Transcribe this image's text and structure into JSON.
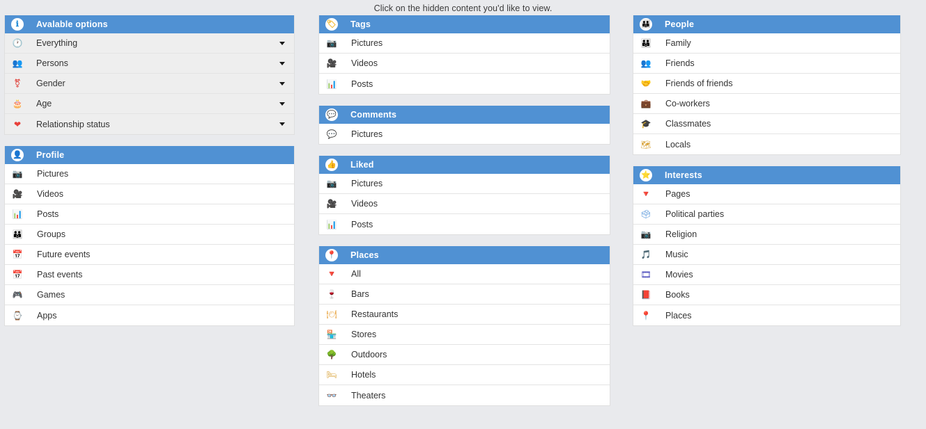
{
  "page": {
    "instruction": "Click on the hidden content you'd like to view.",
    "accent_color": "#5091d3",
    "background_color": "#e9eaed",
    "row_background": "#ffffff",
    "gray_row_background": "#eeeeee",
    "text_color": "#333333"
  },
  "columns": [
    {
      "name": "left",
      "panels": [
        {
          "id": "available-options",
          "title": "Avalable options",
          "header_icon": "info-circle-icon",
          "header_icon_glyph": "ℹ",
          "style": "gray",
          "collapsible": true,
          "items": [
            {
              "label": "Everything",
              "icon": "clock-icon",
              "glyph": "🕐"
            },
            {
              "label": "Persons",
              "icon": "people-icon",
              "glyph": "👥"
            },
            {
              "label": "Gender",
              "icon": "gender-icon",
              "glyph": "⚧"
            },
            {
              "label": "Age",
              "icon": "birthday-cake-icon",
              "glyph": "🎂"
            },
            {
              "label": "Relationship status",
              "icon": "heart-icon",
              "glyph": "❤"
            }
          ]
        },
        {
          "id": "profile",
          "title": "Profile",
          "header_icon": "person-badge-icon",
          "header_icon_glyph": "👤",
          "style": "white",
          "collapsible": false,
          "items": [
            {
              "label": "Pictures",
              "icon": "camera-icon",
              "glyph": "📷"
            },
            {
              "label": "Videos",
              "icon": "movie-camera-icon",
              "glyph": "🎥"
            },
            {
              "label": "Posts",
              "icon": "bar-chart-icon",
              "glyph": "📊"
            },
            {
              "label": "Groups",
              "icon": "group-icon",
              "glyph": "👪"
            },
            {
              "label": "Future events",
              "icon": "calendar-icon",
              "glyph": "📅"
            },
            {
              "label": "Past events",
              "icon": "calendar-icon",
              "glyph": "📅"
            },
            {
              "label": "Games",
              "icon": "gamepad-icon",
              "glyph": "🎮"
            },
            {
              "label": "Apps",
              "icon": "watch-icon",
              "glyph": "⌚"
            }
          ]
        }
      ]
    },
    {
      "name": "middle",
      "panels": [
        {
          "id": "tags",
          "title": "Tags",
          "header_icon": "tag-icon",
          "header_icon_glyph": "🏷",
          "style": "white",
          "collapsible": false,
          "items": [
            {
              "label": "Pictures",
              "icon": "camera-icon",
              "glyph": "📷"
            },
            {
              "label": "Videos",
              "icon": "movie-camera-icon",
              "glyph": "🎥"
            },
            {
              "label": "Posts",
              "icon": "bar-chart-icon",
              "glyph": "📊"
            }
          ]
        },
        {
          "id": "comments",
          "title": "Comments",
          "header_icon": "comment-icon",
          "header_icon_glyph": "💬",
          "style": "white",
          "collapsible": false,
          "items": [
            {
              "label": "Pictures",
              "icon": "speech-bubble-icon",
              "glyph": "💬"
            }
          ]
        },
        {
          "id": "liked",
          "title": "Liked",
          "header_icon": "thumbs-up-icon",
          "header_icon_glyph": "👍",
          "style": "white",
          "collapsible": false,
          "items": [
            {
              "label": "Pictures",
              "icon": "camera-icon",
              "glyph": "📷"
            },
            {
              "label": "Videos",
              "icon": "movie-camera-icon",
              "glyph": "🎥"
            },
            {
              "label": "Posts",
              "icon": "bar-chart-icon",
              "glyph": "📊"
            }
          ]
        },
        {
          "id": "places",
          "title": "Places",
          "header_icon": "map-pin-icon",
          "header_icon_glyph": "📍",
          "style": "white",
          "collapsible": false,
          "items": [
            {
              "label": "All",
              "icon": "filter-icon",
              "glyph": "🔻"
            },
            {
              "label": "Bars",
              "icon": "wine-glass-icon",
              "glyph": "🍷"
            },
            {
              "label": "Restaurants",
              "icon": "menu-card-icon",
              "glyph": "🍽"
            },
            {
              "label": "Stores",
              "icon": "store-icon",
              "glyph": "🏪"
            },
            {
              "label": "Outdoors",
              "icon": "tree-icon",
              "glyph": "🌳"
            },
            {
              "label": "Hotels",
              "icon": "bed-icon",
              "glyph": "🛏"
            },
            {
              "label": "Theaters",
              "icon": "3d-glasses-icon",
              "glyph": "👓"
            }
          ]
        }
      ]
    },
    {
      "name": "right",
      "panels": [
        {
          "id": "people",
          "title": "People",
          "header_icon": "people-circle-icon",
          "header_icon_glyph": "👪",
          "style": "white",
          "collapsible": false,
          "items": [
            {
              "label": "Family",
              "icon": "family-icon",
              "glyph": "👪"
            },
            {
              "label": "Friends",
              "icon": "two-faces-icon",
              "glyph": "👥"
            },
            {
              "label": "Friends of friends",
              "icon": "handshake-icon",
              "glyph": "🤝"
            },
            {
              "label": "Co-workers",
              "icon": "briefcase-icon",
              "glyph": "💼"
            },
            {
              "label": "Classmates",
              "icon": "graduation-cap-icon",
              "glyph": "🎓"
            },
            {
              "label": "Locals",
              "icon": "map-icon",
              "glyph": "🗺"
            }
          ]
        },
        {
          "id": "interests",
          "title": "Interests",
          "header_icon": "star-icon",
          "header_icon_glyph": "⭐",
          "style": "white",
          "collapsible": false,
          "items": [
            {
              "label": "Pages",
              "icon": "filter-icon",
              "glyph": "🔻"
            },
            {
              "label": "Political parties",
              "icon": "podium-icon",
              "glyph": "🗳"
            },
            {
              "label": "Religion",
              "icon": "camera-icon",
              "glyph": "📷"
            },
            {
              "label": "Music",
              "icon": "music-note-icon",
              "glyph": "🎵"
            },
            {
              "label": "Movies",
              "icon": "film-strip-icon",
              "glyph": "🎞"
            },
            {
              "label": "Books",
              "icon": "book-icon",
              "glyph": "📕"
            },
            {
              "label": "Places",
              "icon": "map-pin-icon",
              "glyph": "📍"
            }
          ]
        }
      ]
    }
  ]
}
